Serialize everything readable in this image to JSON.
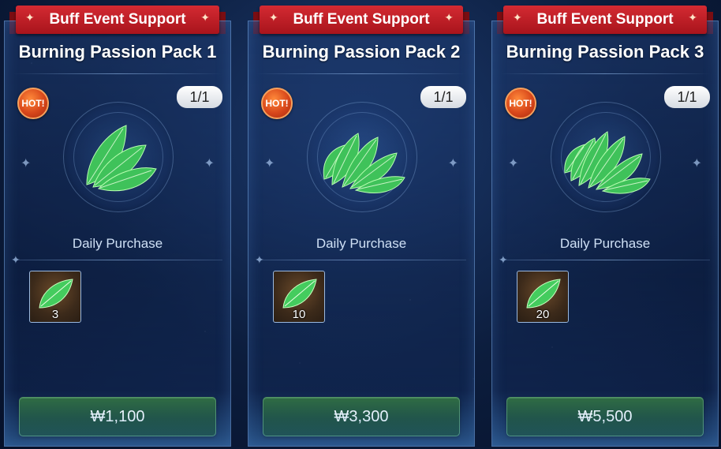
{
  "colors": {
    "ribbon": "#c41e26",
    "buy_button": "#1e5a32",
    "hot_badge": "#d8471b",
    "leaf": "#4fd46a"
  },
  "packs": [
    {
      "ribbon_label": "Buff Event Support",
      "title": "Burning Passion Pack 1",
      "hot_label": "HOT!",
      "limit": "1/1",
      "emblem_icon": "green-leaf-fan-icon",
      "purchase_type": "Daily Purchase",
      "reward_icon": "green-leaf-icon",
      "reward_qty": "3",
      "price": "₩1,100"
    },
    {
      "ribbon_label": "Buff Event Support",
      "title": "Burning Passion Pack 2",
      "hot_label": "HOT!",
      "limit": "1/1",
      "emblem_icon": "green-leaf-fan-icon",
      "purchase_type": "Daily Purchase",
      "reward_icon": "green-leaf-icon",
      "reward_qty": "10",
      "price": "₩3,300"
    },
    {
      "ribbon_label": "Buff Event Support",
      "title": "Burning Passion Pack 3",
      "hot_label": "HOT!",
      "limit": "1/1",
      "emblem_icon": "green-leaf-fan-icon",
      "purchase_type": "Daily Purchase",
      "reward_icon": "green-leaf-icon",
      "reward_qty": "20",
      "price": "₩5,500"
    }
  ]
}
